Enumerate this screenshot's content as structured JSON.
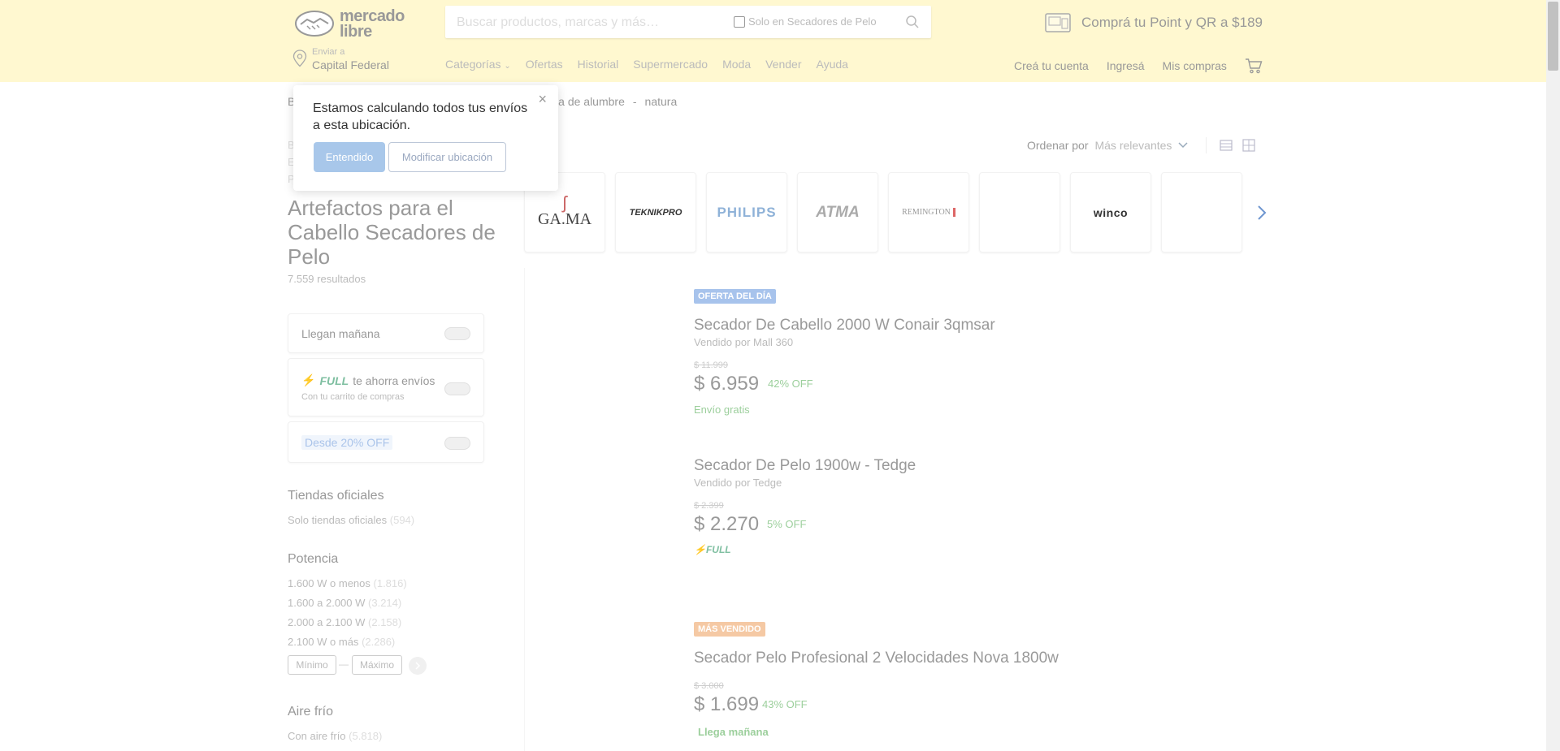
{
  "header": {
    "logo_line1": "mercado",
    "logo_line2": "libre",
    "search_placeholder": "Buscar productos, marcas y más…",
    "search_checkbox_label": "Solo en Secadores de Pelo",
    "promo_text": "Comprá tu Point y QR a $189",
    "location_label": "Enviar a",
    "location_value": "Capital Federal",
    "nav": [
      "Categorías",
      "Ofertas",
      "Historial",
      "Supermercado",
      "Moda",
      "Vender",
      "Ayuda"
    ],
    "account": {
      "create": "Creá tu cuenta",
      "login": "Ingresá",
      "purchases": "Mis compras"
    }
  },
  "breadcrumb": {
    "first": "B",
    "items": [
      "piedra de alumbre",
      "natura"
    ]
  },
  "sidebar": {
    "hidden_letters": [
      "B",
      "E",
      "P"
    ],
    "title": "Artefactos para el Cabello Secadores de Pelo",
    "results": "7.559 resultados",
    "filters": {
      "tomorrow": "Llegan mañana",
      "full_badge": "FULL",
      "full_text": "te ahorra envíos",
      "full_sub": "Con tu carrito de compras",
      "discount": "Desde 20% OFF"
    },
    "official_title": "Tiendas oficiales",
    "official_link": {
      "label": "Solo tiendas oficiales",
      "count": "(594)"
    },
    "power_title": "Potencia",
    "power_options": [
      {
        "label": "1.600 W o menos",
        "count": "(1.816)"
      },
      {
        "label": "1.600 a 2.000 W",
        "count": "(3.214)"
      },
      {
        "label": "2.000 a 2.100 W",
        "count": "(2.158)"
      },
      {
        "label": "2.100 W o más",
        "count": "(2.286)"
      }
    ],
    "range": {
      "min": "Mínimo",
      "max": "Máximo",
      "sep": "—"
    },
    "cold_title": "Aire frío",
    "cold_link": {
      "label": "Con aire frío",
      "count": "(5.818)"
    }
  },
  "sort": {
    "label": "Ordenar por",
    "value": "Más relevantes"
  },
  "brands": [
    "GA.MA",
    "TEKNIKPRO",
    "PHILIPS",
    "ATMA",
    "REMINGTON",
    "",
    "winco",
    ""
  ],
  "products": [
    {
      "badge": "OFERTA DEL DÍA",
      "title": "Secador De Cabello 2000 W Conair 3qmsar",
      "seller": "Vendido por Mall 360",
      "old_price": "$ 11.999",
      "price": "$ 6.959",
      "discount": "42% OFF",
      "shipping": "Envío gratis"
    },
    {
      "title": "Secador De Pelo 1900w - Tedge",
      "seller": "Vendido por Tedge",
      "old_price": "$ 2.399",
      "price": "$ 2.270",
      "discount": "5% OFF",
      "shipping": "FULL"
    },
    {
      "badge": "MÁS VENDIDO",
      "title": "Secador Pelo Profesional 2 Velocidades Nova 1800w",
      "old_price": "$ 3.000",
      "price": "$ 1.699",
      "discount": "43% OFF",
      "shipping": "Llega mañana"
    }
  ],
  "popup": {
    "message": "Estamos calculando todos tus envíos a esta ubicación.",
    "primary": "Entendido",
    "secondary": "Modificar ubicación",
    "close": "×"
  },
  "colors": {
    "header_bg": "#fff8d0",
    "badge_offer": "#a7c3ec",
    "badge_best": "#f5c9a4",
    "shipping_green": "#9ccf9c"
  }
}
